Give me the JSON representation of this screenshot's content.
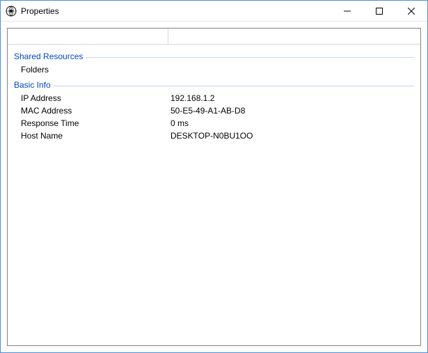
{
  "window": {
    "title": "Properties"
  },
  "sections": {
    "shared": {
      "title": "Shared Resources",
      "folders_label": "Folders"
    },
    "basic": {
      "title": "Basic Info",
      "ip_label": "IP Address",
      "ip_value": "192.168.1.2",
      "mac_label": "MAC Address",
      "mac_value": "50-E5-49-A1-AB-D8",
      "response_label": "Response Time",
      "response_value": "0 ms",
      "host_label": "Host Name",
      "host_value": "DESKTOP-N0BU1OO"
    }
  }
}
